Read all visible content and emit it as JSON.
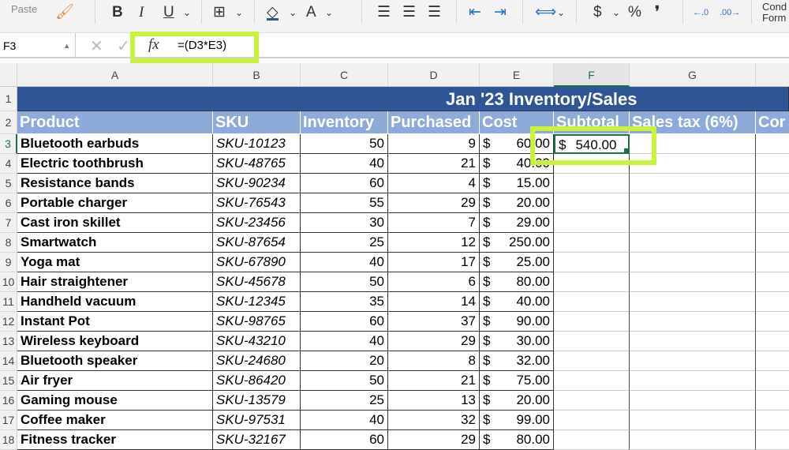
{
  "ribbon": {
    "paste_label": "Paste",
    "bold": "B",
    "italic": "I",
    "underline": "U",
    "font_color": "A",
    "currency": "$",
    "percent": "%",
    "comma": "❜",
    "inc_decimal": "←.0",
    "dec_decimal": ".00→",
    "conditional_formatting": "Cond Form",
    "accent_fill": "#2f5597"
  },
  "formula_bar": {
    "name_box": "F3",
    "fx": "fx",
    "formula": "=(D3*E3)"
  },
  "columns": [
    "A",
    "B",
    "C",
    "D",
    "E",
    "F",
    "G",
    ""
  ],
  "selected_column": "F",
  "title": "Jan '23 Inventory/Sales",
  "headers": [
    "Product",
    "SKU",
    "Inventory",
    "Purchased",
    "Cost",
    "Subtotal",
    "Sales tax (6%)",
    "Cor"
  ],
  "rows": [
    {
      "n": "3",
      "product": "Bluetooth earbuds",
      "sku": "SKU-10123",
      "inventory": "50",
      "purchased": "9",
      "cost": "60.00",
      "subtotal": "540.00"
    },
    {
      "n": "4",
      "product": "Electric toothbrush",
      "sku": "SKU-48765",
      "inventory": "40",
      "purchased": "21",
      "cost": "40.00"
    },
    {
      "n": "5",
      "product": "Resistance bands",
      "sku": "SKU-90234",
      "inventory": "60",
      "purchased": "4",
      "cost": "15.00"
    },
    {
      "n": "6",
      "product": "Portable charger",
      "sku": "SKU-76543",
      "inventory": "55",
      "purchased": "29",
      "cost": "20.00"
    },
    {
      "n": "7",
      "product": "Cast iron skillet",
      "sku": "SKU-23456",
      "inventory": "30",
      "purchased": "7",
      "cost": "29.00"
    },
    {
      "n": "8",
      "product": "Smartwatch",
      "sku": "SKU-87654",
      "inventory": "25",
      "purchased": "12",
      "cost": "250.00"
    },
    {
      "n": "9",
      "product": "Yoga mat",
      "sku": "SKU-67890",
      "inventory": "40",
      "purchased": "17",
      "cost": "25.00"
    },
    {
      "n": "10",
      "product": "Hair straightener",
      "sku": "SKU-45678",
      "inventory": "50",
      "purchased": "6",
      "cost": "80.00"
    },
    {
      "n": "11",
      "product": "Handheld vacuum",
      "sku": "SKU-12345",
      "inventory": "35",
      "purchased": "14",
      "cost": "40.00"
    },
    {
      "n": "12",
      "product": "Instant Pot",
      "sku": "SKU-98765",
      "inventory": "60",
      "purchased": "37",
      "cost": "90.00"
    },
    {
      "n": "13",
      "product": "Wireless keyboard",
      "sku": "SKU-43210",
      "inventory": "40",
      "purchased": "29",
      "cost": "30.00"
    },
    {
      "n": "14",
      "product": "Bluetooth speaker",
      "sku": "SKU-24680",
      "inventory": "20",
      "purchased": "8",
      "cost": "32.00"
    },
    {
      "n": "15",
      "product": "Air fryer",
      "sku": "SKU-86420",
      "inventory": "50",
      "purchased": "21",
      "cost": "75.00"
    },
    {
      "n": "16",
      "product": "Gaming mouse",
      "sku": "SKU-13579",
      "inventory": "25",
      "purchased": "13",
      "cost": "20.00"
    },
    {
      "n": "17",
      "product": "Coffee maker",
      "sku": "SKU-97531",
      "inventory": "40",
      "purchased": "32",
      "cost": "99.00"
    },
    {
      "n": "18",
      "product": "Fitness tracker",
      "sku": "SKU-32167",
      "inventory": "60",
      "purchased": "29",
      "cost": "80.00"
    }
  ],
  "currency_symbol": "$",
  "colors": {
    "title_bg": "#2f5597",
    "header_bg": "#8eaadb",
    "highlight": "#c8f23c",
    "selection": "#1e7145"
  }
}
